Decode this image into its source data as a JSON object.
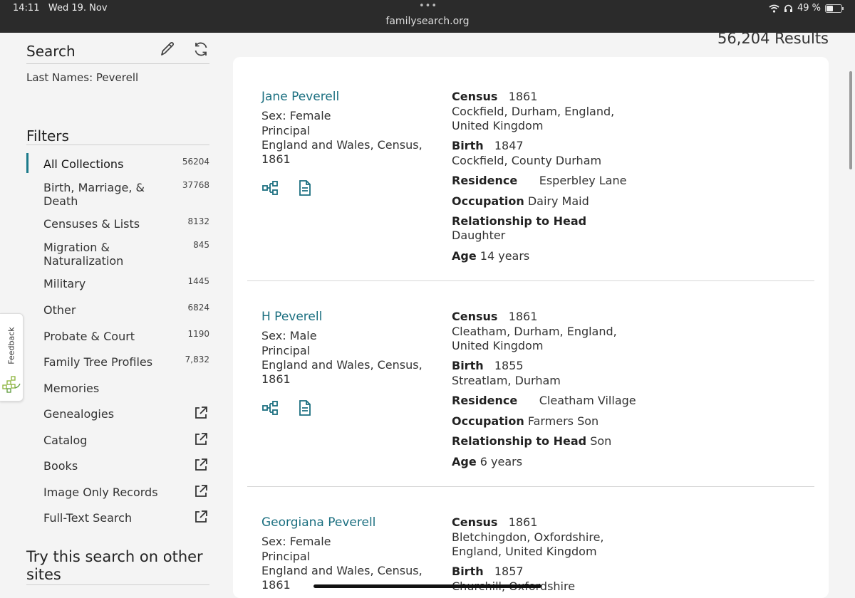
{
  "status_bar": {
    "time": "14:11",
    "date": "Wed 19. Nov",
    "url": "familysearch.org",
    "battery": "49 %"
  },
  "sidebar": {
    "search_title": "Search",
    "last_names": "Last Names: Peverell",
    "filters_title": "Filters",
    "items": [
      {
        "label": "All Collections",
        "count": "56204"
      },
      {
        "label": "Birth, Marriage, & Death",
        "count": "37768"
      },
      {
        "label": "Censuses & Lists",
        "count": "8132"
      },
      {
        "label": "Migration & Naturalization",
        "count": "845"
      },
      {
        "label": "Military",
        "count": "1445"
      },
      {
        "label": "Other",
        "count": "6824"
      },
      {
        "label": "Probate & Court",
        "count": "1190"
      },
      {
        "label": "Family Tree Profiles",
        "count": "7,832"
      },
      {
        "label": "Memories",
        "count": ""
      },
      {
        "label": "Genealogies",
        "count": ""
      },
      {
        "label": "Catalog",
        "count": ""
      },
      {
        "label": "Books",
        "count": ""
      },
      {
        "label": "Image Only Records",
        "count": ""
      },
      {
        "label": "Full-Text Search",
        "count": ""
      }
    ],
    "try_title": "Try this search on other sites"
  },
  "feedback_label": "Feedback",
  "results_count": "56,204 Results",
  "records": [
    {
      "name": "Jane Peverell",
      "sex": "Sex: Female",
      "role": "Principal",
      "collection_l1": "England and Wales, Census,",
      "collection_l2": "1861",
      "census_label": "Census",
      "census_year": "1861",
      "census_place_l1": "Cockfield, Durham, England,",
      "census_place_l2": "United Kingdom",
      "birth_label": "Birth",
      "birth_year": "1847",
      "birth_place": "Cockfield, County Durham",
      "residence_label": "Residence",
      "residence": "Esperbley Lane",
      "occupation_label": "Occupation",
      "occupation": "Dairy Maid",
      "relationship_label": "Relationship to Head",
      "relationship": "Daughter",
      "age_label": "Age",
      "age": "14 years"
    },
    {
      "name": "H Peverell",
      "sex": "Sex: Male",
      "role": "Principal",
      "collection_l1": "England and Wales, Census,",
      "collection_l2": "1861",
      "census_label": "Census",
      "census_year": "1861",
      "census_place_l1": "Cleatham, Durham, England,",
      "census_place_l2": "United Kingdom",
      "birth_label": "Birth",
      "birth_year": "1855",
      "birth_place": "Streatlam, Durham",
      "residence_label": "Residence",
      "residence": "Cleatham Village",
      "occupation_label": "Occupation",
      "occupation": "Farmers Son",
      "relationship_label": "Relationship to Head",
      "relationship": "Son",
      "age_label": "Age",
      "age": "6 years"
    },
    {
      "name": "Georgiana Peverell",
      "sex": "Sex: Female",
      "role": "Principal",
      "collection_l1": "England and Wales, Census,",
      "collection_l2": "1861",
      "census_label": "Census",
      "census_year": "1861",
      "census_place_l1": "Bletchingdon, Oxfordshire,",
      "census_place_l2": "England, United Kingdom",
      "birth_label": "Birth",
      "birth_year": "1857",
      "birth_place": "Churchill, Oxfordshire"
    }
  ],
  "colors": {
    "accent": "#1b6f80",
    "topbar": "#2b2b2b",
    "page_bg": "#f4f4f4"
  }
}
